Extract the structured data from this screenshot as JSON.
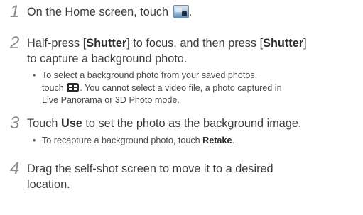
{
  "steps": [
    {
      "number": "1",
      "text_before": "On the Home screen, touch ",
      "icon": "camera-image-icon",
      "text_after": "."
    },
    {
      "number": "2",
      "line1_a": "Half-press [",
      "shutter": "Shutter",
      "line1_b": "] to focus, and then press [",
      "line1_c": "]",
      "line2": "to capture a background photo.",
      "bullet": {
        "line1": "To select a background photo from your saved photos,",
        "line2_a": "touch ",
        "icon": "gallery-grid-icon",
        "line2_b": ". You cannot select a video file, a photo captured in",
        "line3": "Live Panorama or 3D Photo mode."
      }
    },
    {
      "number": "3",
      "text_a": "Touch ",
      "use": "Use",
      "text_b": " to set the photo as the background image.",
      "bullet": {
        "text_a": "To recapture a background photo, touch ",
        "retake": "Retake",
        "text_b": "."
      }
    },
    {
      "number": "4",
      "line1": "Drag the self-shot screen to move it to a desired",
      "line2": "location."
    }
  ],
  "colors": {
    "number": "#8c8c8c",
    "text": "#3d3d3d"
  }
}
